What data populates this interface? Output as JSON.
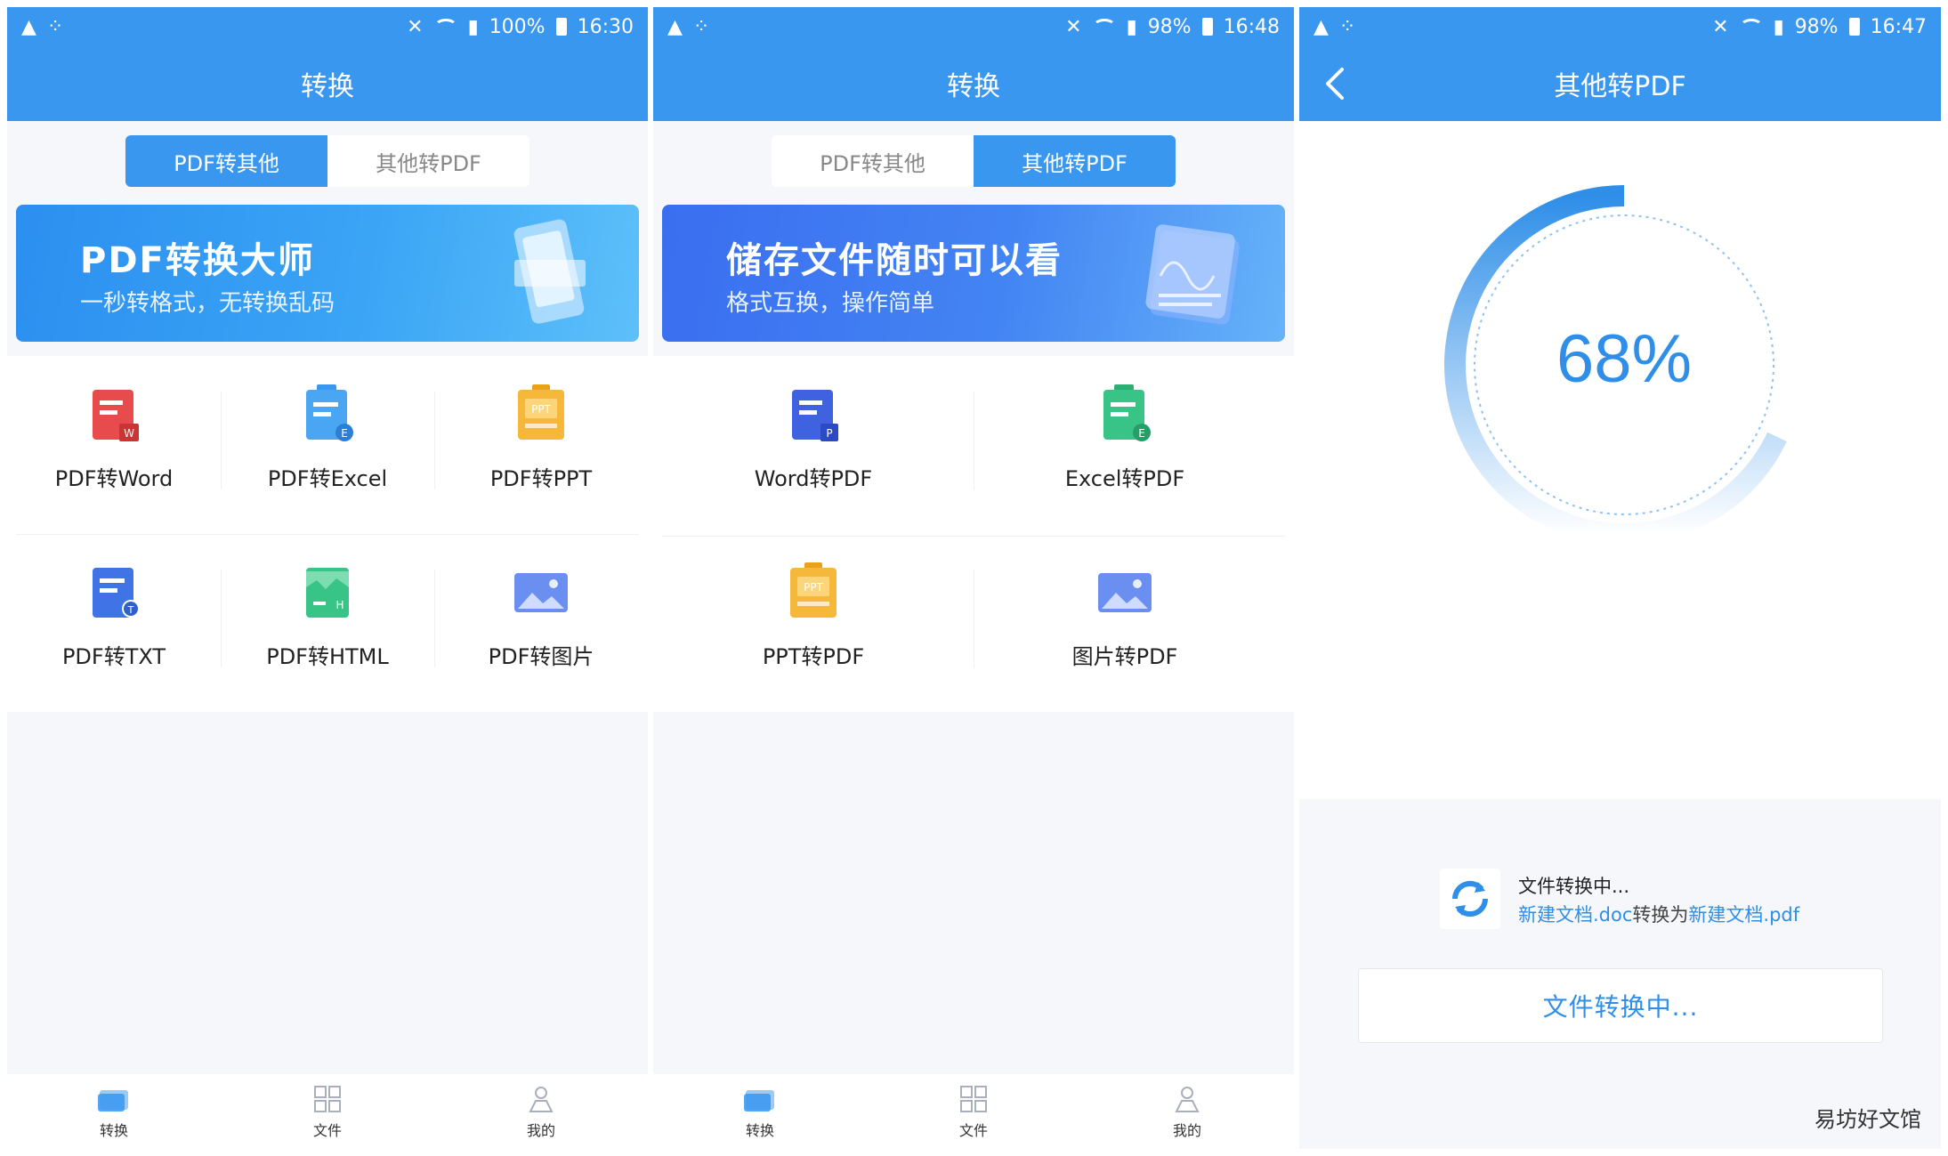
{
  "colors": {
    "primary": "#3a97ef",
    "accent_text": "#2e8ee8",
    "background": "#f6f7fb"
  },
  "screen1": {
    "status": {
      "battery": "100%",
      "time": "16:30"
    },
    "title": "转换",
    "tabs": [
      {
        "label": "PDF转其他",
        "active": true
      },
      {
        "label": "其他转PDF",
        "active": false
      }
    ],
    "banner": {
      "title": "PDF转换大师",
      "subtitle": "一秒转格式，无转换乱码"
    },
    "tools": [
      {
        "label": "PDF转Word",
        "icon": "word-doc-icon"
      },
      {
        "label": "PDF转Excel",
        "icon": "excel-doc-icon"
      },
      {
        "label": "PDF转PPT",
        "icon": "ppt-doc-icon"
      },
      {
        "label": "PDF转TXT",
        "icon": "txt-doc-icon"
      },
      {
        "label": "PDF转HTML",
        "icon": "html-doc-icon"
      },
      {
        "label": "PDF转图片",
        "icon": "image-doc-icon"
      }
    ],
    "nav": [
      {
        "label": "转换",
        "icon": "folder-icon"
      },
      {
        "label": "文件",
        "icon": "grid-icon"
      },
      {
        "label": "我的",
        "icon": "user-icon"
      }
    ]
  },
  "screen2": {
    "status": {
      "battery": "98%",
      "time": "16:48"
    },
    "title": "转换",
    "tabs": [
      {
        "label": "PDF转其他",
        "active": false
      },
      {
        "label": "其他转PDF",
        "active": true
      }
    ],
    "banner": {
      "title": "储存文件随时可以看",
      "subtitle": "格式互换，操作简单"
    },
    "tools": [
      {
        "label": "Word转PDF",
        "icon": "word-to-pdf-icon"
      },
      {
        "label": "Excel转PDF",
        "icon": "excel-to-pdf-icon"
      },
      {
        "label": "PPT转PDF",
        "icon": "ppt-to-pdf-icon"
      },
      {
        "label": "图片转PDF",
        "icon": "image-to-pdf-icon"
      }
    ],
    "nav": [
      {
        "label": "转换",
        "icon": "folder-icon"
      },
      {
        "label": "文件",
        "icon": "grid-icon"
      },
      {
        "label": "我的",
        "icon": "user-icon"
      }
    ]
  },
  "screen3": {
    "status": {
      "battery": "98%",
      "time": "16:47"
    },
    "title": "其他转PDF",
    "progress": {
      "percent_label": "68%",
      "value": 0.68
    },
    "conversion": {
      "status": "文件转换中...",
      "source": "新建文档.doc",
      "connector": "转换为",
      "target": "新建文档.pdf"
    },
    "button_label": "文件转换中..."
  },
  "watermark": "易坊好文馆"
}
